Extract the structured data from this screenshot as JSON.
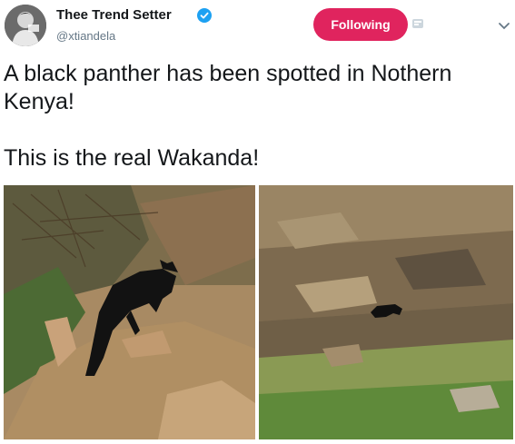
{
  "author": {
    "name": "Thee Trend Setter",
    "handle": "@xtiandela",
    "avatar_icon": "profile-avatar",
    "verified_icon": "verified-badge-icon"
  },
  "actions": {
    "follow_label": "Following",
    "follow_color": "#e0245e",
    "notifications_icon": "notification-bell-icon",
    "more_icon": "chevron-down-icon"
  },
  "tweet": {
    "text": "A black panther has been spotted in Nothern Kenya!\n\nThis is the real Wakanda!"
  },
  "media": {
    "photos": [
      {
        "icon": "panther-on-hillside-photo"
      },
      {
        "icon": "panther-on-rocky-slope-photo"
      }
    ]
  },
  "colors": {
    "text": "#14171a",
    "secondary_text": "#657786",
    "verified": "#1da1f2"
  }
}
